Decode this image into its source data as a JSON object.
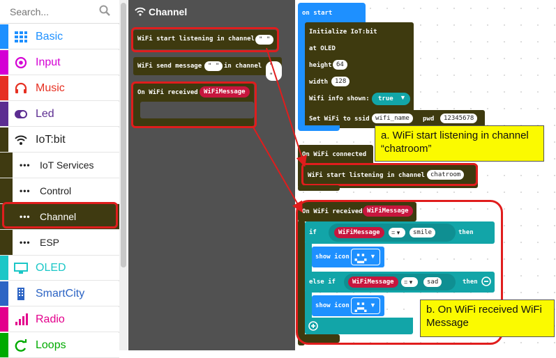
{
  "search": {
    "placeholder": "Search..."
  },
  "categories": [
    {
      "label": "Basic",
      "icon": "grid-icon",
      "color": "#1e90ff"
    },
    {
      "label": "Input",
      "icon": "target-icon",
      "color": "#d400d4"
    },
    {
      "label": "Music",
      "icon": "headphones-icon",
      "color": "#e63022"
    },
    {
      "label": "Led",
      "icon": "toggle-icon",
      "color": "#5c2d91"
    },
    {
      "label": "IoT:bit",
      "icon": "wifi-icon",
      "color": "#3f3a11"
    },
    {
      "label": "OLED",
      "icon": "monitor-icon",
      "color": "#1bc7c7"
    },
    {
      "label": "SmartCity",
      "icon": "building-icon",
      "color": "#2c64c4"
    },
    {
      "label": "Radio",
      "icon": "bars-icon",
      "color": "#e3008c"
    },
    {
      "label": "Loops",
      "icon": "loop-icon",
      "color": "#00aa00"
    }
  ],
  "subcategories": [
    {
      "label": "IoT Services"
    },
    {
      "label": "Control"
    },
    {
      "label": "Channel"
    },
    {
      "label": "ESP"
    }
  ],
  "flyout": {
    "title": "Channel",
    "block_listen": {
      "text": "WiFi start listening in channel",
      "value": "\" \""
    },
    "block_send": {
      "text": "WiFi send message",
      "value1": "\" \"",
      "mid": "in channel",
      "value2": "\" \""
    },
    "block_received": {
      "text": "On WiFi received",
      "param": "WiFiMessage"
    }
  },
  "workspace": {
    "on_start": {
      "header": "on start",
      "init": "Initialize IoT:bit",
      "at_oled": "at OLED",
      "height_label": "height",
      "height_value": "64",
      "width_label": "width",
      "width_value": "128",
      "wifi_info_label": "Wifi info shown:",
      "wifi_info_value": "true",
      "ssid_label": "Set WiFi to ssid",
      "ssid_value": "wifi_name",
      "pwd_label": "pwd",
      "pwd_value": "12345678"
    },
    "on_connected": {
      "header": "On WiFi connected",
      "listen_text": "WiFi start listening in channel",
      "listen_value": "chatroom"
    },
    "on_received": {
      "header": "On WiFi received",
      "param": "WiFiMessage",
      "if_label": "if",
      "cond_var": "WiFiMessage",
      "op": "=",
      "value1": "smile",
      "then": "then",
      "show_icon": "show icon",
      "else_if_label": "else if",
      "cond_var2": "WiFiMessage",
      "op2": "=",
      "value2": "sad",
      "then2": "then",
      "show_icon2": "show icon"
    }
  },
  "callouts": {
    "a": "a. WiFi start listening in channel “chatroom”",
    "b": "b. On WiFi received WiFi Message"
  },
  "colors": {
    "iot": "#3f3a11",
    "highlight": "#e01d1d",
    "logic": "#12a5a8",
    "basic": "#1e90ff",
    "callout": "#fbfa00"
  }
}
